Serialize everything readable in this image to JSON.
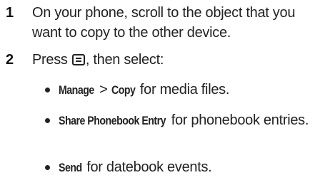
{
  "steps": [
    {
      "number": "1",
      "text": "On your phone, scroll to the object that you want to copy to the other device."
    },
    {
      "number": "2",
      "text_before_icon": "Press ",
      "icon": "menu-key-icon",
      "text_after_icon": ", then select:"
    }
  ],
  "bullets": [
    {
      "kw1": "Manage",
      "sep": " > ",
      "kw2": "Copy",
      "rest": " for media files."
    },
    {
      "kw1": "Share Phonebook Entry",
      "rest": " for phonebook entries."
    },
    {
      "kw1": "Send",
      "rest": " for datebook events."
    }
  ]
}
